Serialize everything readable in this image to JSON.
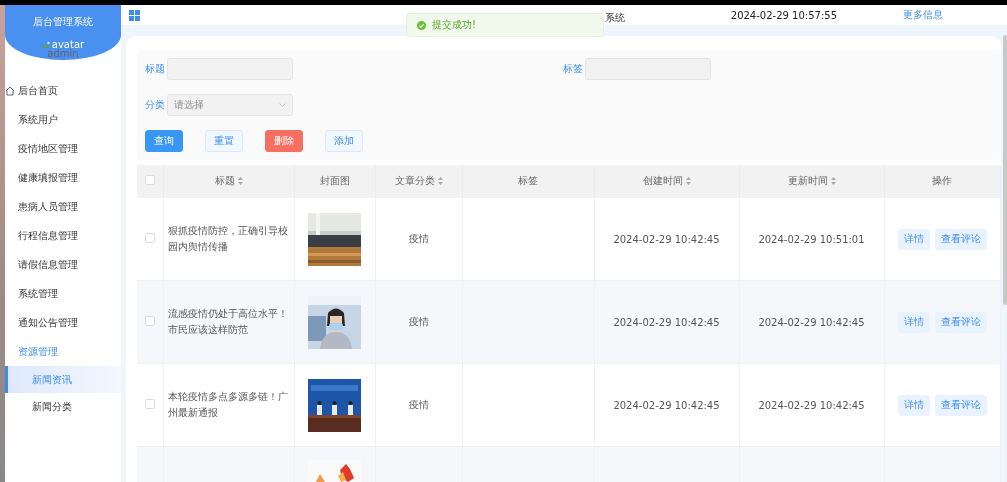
{
  "sidebar": {
    "logo_title": "后台管理系统",
    "avatar_alt": "avatar",
    "username": "admin",
    "items": [
      {
        "label": "后台首页",
        "kind": "home",
        "selected": false
      },
      {
        "label": "系统用户",
        "selected": false
      },
      {
        "label": "疫情地区管理",
        "selected": false
      },
      {
        "label": "健康填报管理",
        "selected": false
      },
      {
        "label": "患病人员管理",
        "selected": false
      },
      {
        "label": "行程信息管理",
        "selected": false
      },
      {
        "label": "请假信息管理",
        "selected": false
      },
      {
        "label": "系统管理",
        "selected": false
      },
      {
        "label": "通知公告管理",
        "selected": false
      },
      {
        "label": "资源管理",
        "selected": false,
        "expanded": true,
        "children": [
          {
            "label": "新闻资讯",
            "selected": true
          },
          {
            "label": "新闻分类",
            "selected": false
          }
        ]
      }
    ]
  },
  "header": {
    "title_visible": "系统",
    "datetime": "2024-02-29 10:57:55",
    "more_link": "更多信息"
  },
  "toast": {
    "kind": "success",
    "message": "提交成功!"
  },
  "filters": {
    "title_label": "标题",
    "tag_label": "标签",
    "category_label": "分类",
    "category_placeholder": "请选择"
  },
  "buttons": [
    {
      "label": "查询",
      "kind": "primary"
    },
    {
      "label": "重置",
      "kind": "plain"
    },
    {
      "label": "删除",
      "kind": "danger"
    },
    {
      "label": "添加",
      "kind": "plain"
    }
  ],
  "table": {
    "select_all_checked": false,
    "columns": [
      {
        "label": "标题",
        "sortable": true
      },
      {
        "label": "封面图",
        "sortable": false
      },
      {
        "label": "文章分类",
        "sortable": true
      },
      {
        "label": "标签",
        "sortable": false
      },
      {
        "label": "创建时间",
        "sortable": true
      },
      {
        "label": "更新时间",
        "sortable": true
      },
      {
        "label": "操作",
        "sortable": false
      }
    ],
    "rows": [
      {
        "checked": false,
        "title": "狠抓疫情防控，正确引导校园内舆情传播",
        "cover": {
          "kind": "picture"
        },
        "category": "疫情",
        "created": "2024-02-29 10:42:45",
        "updated": "2024-02-29 10:51:01",
        "actions": [
          "详情",
          "查看评论"
        ]
      },
      {
        "checked": false,
        "title": "流感疫情仍处于高位水平！市民应该这样防范",
        "cover": {
          "kind": "picture"
        },
        "category": "疫情",
        "created": "2024-02-29 10:42:45",
        "updated": "2024-02-29 10:42:45",
        "actions": [
          "详情",
          "查看评论"
        ]
      },
      {
        "checked": false,
        "title": "本轮疫情多点多源多链！广州最新通报",
        "cover": {
          "kind": "picture"
        },
        "category": "疫情",
        "created": "2024-02-29 10:42:45",
        "updated": "2024-02-29 10:42:45",
        "actions": [
          "详情",
          "查看评论"
        ]
      },
      {
        "cover": {
          "kind": "picture"
        }
      }
    ]
  }
}
